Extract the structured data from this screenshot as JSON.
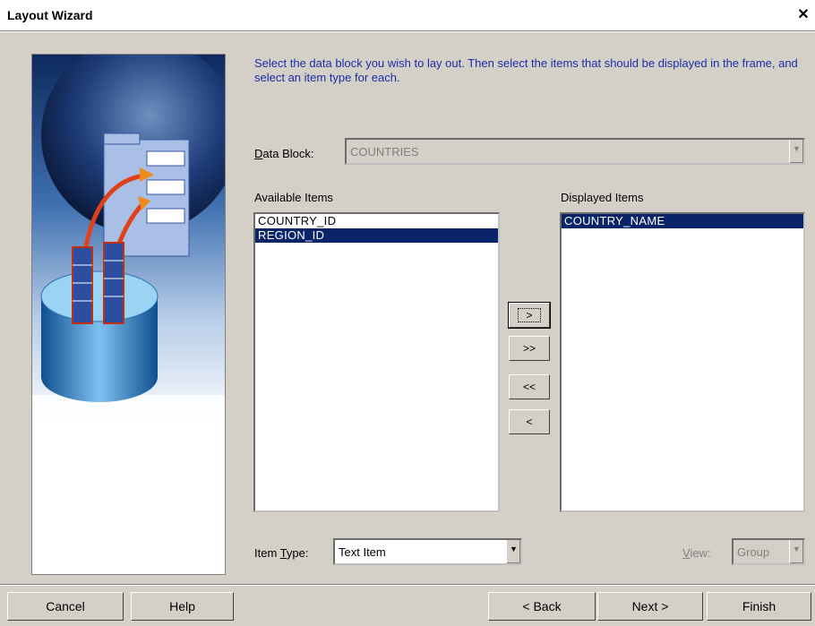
{
  "window": {
    "title": "Layout Wizard"
  },
  "instructions": "Select the data block you wish to lay out. Then select the items that should be displayed in the frame, and select an item type for each.",
  "data_block": {
    "label_pre": "D",
    "label_rest": "ata Block:",
    "value": "COUNTRIES"
  },
  "available": {
    "label": "Available Items",
    "items": [
      "COUNTRY_ID",
      "REGION_ID"
    ],
    "selected_index": 1
  },
  "displayed": {
    "label": "Displayed Items",
    "items": [
      "COUNTRY_NAME"
    ],
    "selected_index": 0
  },
  "move_buttons": {
    "add": ">",
    "add_all": ">>",
    "remove_all": "<<",
    "remove": "<"
  },
  "item_type": {
    "label_pre": "Item ",
    "label_u": "T",
    "label_post": "ype:",
    "value": "Text Item"
  },
  "view": {
    "label_u": "V",
    "label_rest": "iew:",
    "value": "Group"
  },
  "buttons": {
    "cancel": "Cancel",
    "help": "Help",
    "back": "< Back",
    "next": "Next >",
    "finish": "Finish"
  },
  "icons": {
    "close": "close-icon",
    "dropdown": "chevron-down-icon",
    "illustration": "wizard-illustration"
  }
}
